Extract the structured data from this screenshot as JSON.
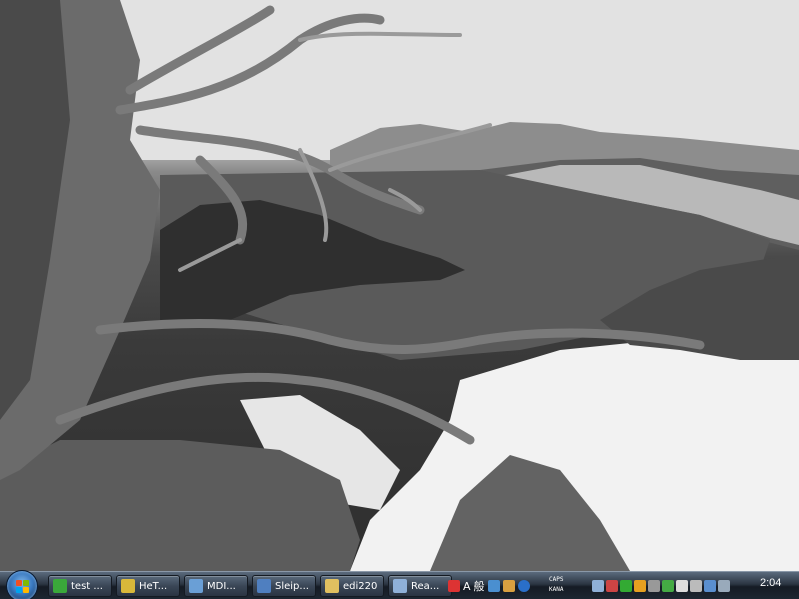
{
  "taskbar": {
    "tasks": [
      {
        "label": "test ...",
        "icon": "green-arrow-icon",
        "color": "#3aa83a"
      },
      {
        "label": "HeT...",
        "icon": "puzzle-icon",
        "color": "#d9b83a"
      },
      {
        "label": "MDI...",
        "icon": "window-icon",
        "color": "#6a9fd6"
      },
      {
        "label": "Sleip...",
        "icon": "app-icon",
        "color": "#4f7fc0"
      },
      {
        "label": "edi220",
        "icon": "folder-icon",
        "color": "#e0c060"
      },
      {
        "label": "Rea...",
        "icon": "reader-icon",
        "color": "#8fb0d8"
      }
    ],
    "language": {
      "a": "A",
      "kana": "般"
    },
    "caps": {
      "line1": "CAPS",
      "line2": "KANA"
    },
    "clock": "2:04"
  }
}
